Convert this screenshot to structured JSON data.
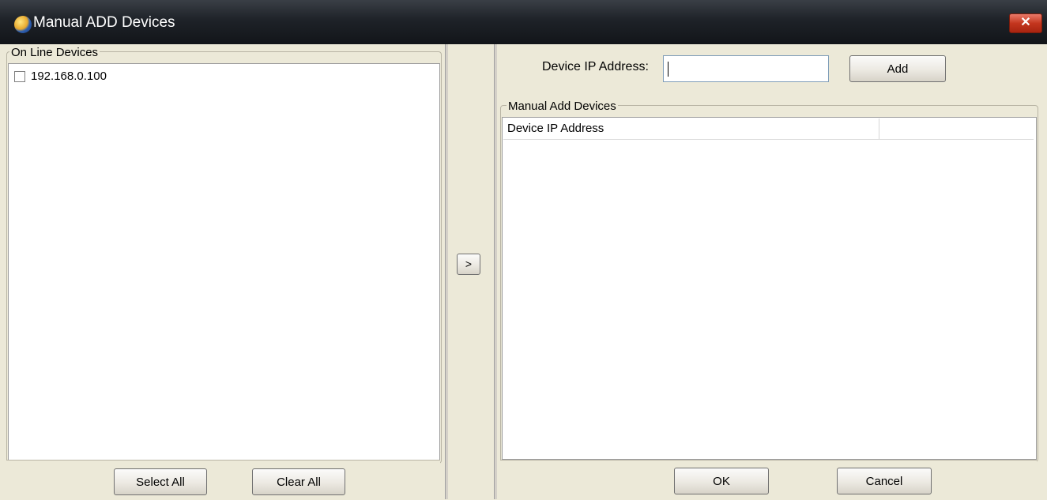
{
  "window": {
    "title": "Manual ADD Devices",
    "close_label": "✕"
  },
  "left": {
    "group_label": "On Line Devices",
    "devices": [
      {
        "ip": "192.168.0.100",
        "checked": false
      }
    ],
    "select_all_label": "Select All",
    "clear_all_label": "Clear All"
  },
  "middle": {
    "transfer_label": ">"
  },
  "right": {
    "ip_label": "Device IP Address:",
    "ip_value": "",
    "add_label": "Add",
    "group_label": "Manual Add Devices",
    "table_columns": [
      "Device IP Address",
      ""
    ],
    "table_rows": [],
    "ok_label": "OK",
    "cancel_label": "Cancel"
  },
  "colors": {
    "title_bar": "#1e2228",
    "close_button": "#c4361e",
    "dialog_face": "#ece9d8"
  }
}
